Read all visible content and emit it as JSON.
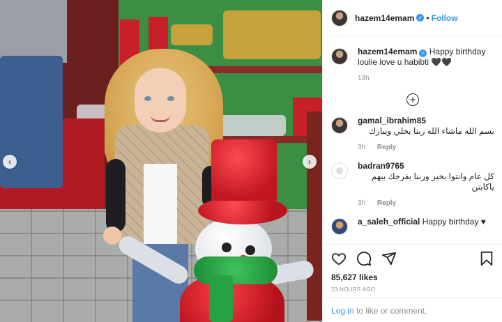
{
  "post": {
    "author": "hazem14emam",
    "verified": true,
    "header_separator": "•",
    "follow_label": "Follow"
  },
  "caption": {
    "author": "hazem14emam",
    "text": "Happy birthday loulie love u habibti 🖤🖤",
    "time": "13h"
  },
  "load_more_icon": "plus-circle-icon",
  "comments": [
    {
      "author": "gamal_ibrahim85",
      "text": "بسم الله ماشاء الله ربنا يخلي ويبارك",
      "time": "3h",
      "reply_label": "Reply"
    },
    {
      "author": "badran9765",
      "text": "كل عام وانتوا بخير وربنا يفرحك بيهم ياكابتن",
      "time": "3h",
      "reply_label": "Reply"
    },
    {
      "author": "a_saleh_official",
      "text": "Happy birthday ♥"
    }
  ],
  "actions": {
    "icons": [
      "heart-icon",
      "comment-icon",
      "share-icon",
      "bookmark-icon"
    ],
    "likes": "85,627 likes",
    "time_ago": "23 HOURS AGO"
  },
  "login": {
    "link": "Log in",
    "rest": " to like or comment."
  },
  "carousel": {
    "prev": "‹",
    "next": "›"
  },
  "colors": {
    "accent": "#3897f0",
    "text": "#262626",
    "muted": "#8e8e8e"
  }
}
